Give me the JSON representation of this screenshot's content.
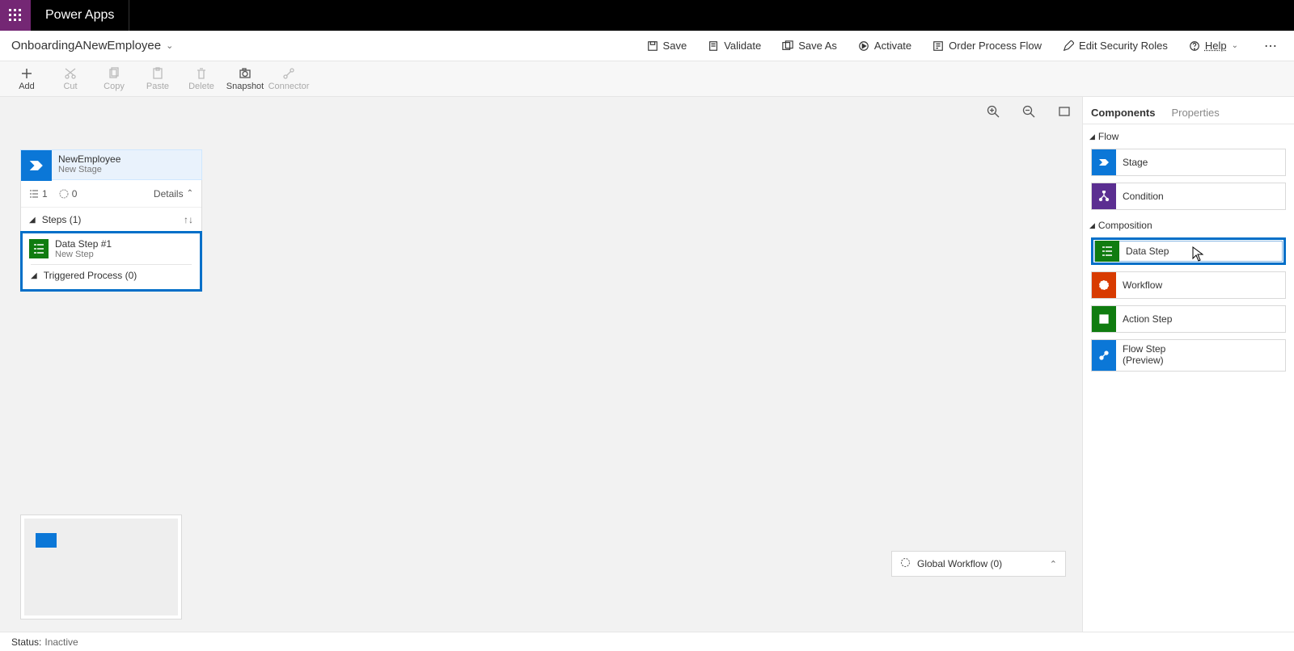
{
  "app_name": "Power Apps",
  "doc_title": "OnboardingANewEmployee",
  "commands": {
    "save": "Save",
    "validate": "Validate",
    "save_as": "Save As",
    "activate": "Activate",
    "order": "Order Process Flow",
    "edit_roles": "Edit Security Roles",
    "help": "Help"
  },
  "toolbar": {
    "add": "Add",
    "cut": "Cut",
    "copy": "Copy",
    "paste": "Paste",
    "delete": "Delete",
    "snapshot": "Snapshot",
    "connector": "Connector"
  },
  "stage": {
    "title": "NewEmployee",
    "subtitle": "New Stage",
    "steps_count": "1",
    "workflow_count": "0",
    "details": "Details",
    "steps_label": "Steps (1)",
    "data_step_title": "Data Step #1",
    "data_step_sub": "New Step",
    "triggered_label": "Triggered Process (0)"
  },
  "global_wf": {
    "label": "Global Workflow (0)"
  },
  "right": {
    "tab_components": "Components",
    "tab_properties": "Properties",
    "group_flow": "Flow",
    "group_composition": "Composition",
    "stage": "Stage",
    "condition": "Condition",
    "data_step": "Data Step",
    "workflow": "Workflow",
    "action_step": "Action Step",
    "flow_step": "Flow Step\n(Preview)"
  },
  "status": {
    "label": "Status:",
    "value": "Inactive"
  }
}
